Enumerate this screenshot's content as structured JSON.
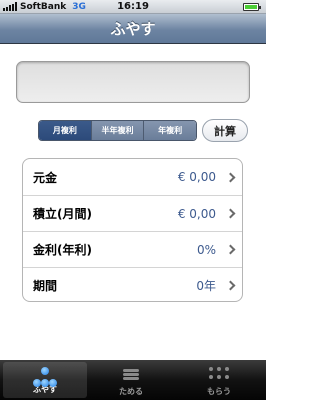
{
  "status_bar": {
    "carrier": "SoftBank",
    "network": "3G",
    "time": "16:19"
  },
  "nav": {
    "title": "ふやす"
  },
  "display": {
    "value": ""
  },
  "segments": [
    {
      "label": "月複利",
      "selected": true
    },
    {
      "label": "半年複利",
      "selected": false
    },
    {
      "label": "年複利",
      "selected": false
    }
  ],
  "calc_button": {
    "label": "計算"
  },
  "rows": [
    {
      "label": "元金",
      "value": "€ 0,00"
    },
    {
      "label": "積立(月間)",
      "value": "€ 0,00"
    },
    {
      "label": "金利(年利)",
      "value": "0%"
    },
    {
      "label": "期間",
      "value": "0年"
    }
  ],
  "tabs": [
    {
      "label": "ふやす",
      "icon": "three-dots-icon",
      "selected": true
    },
    {
      "label": "ためる",
      "icon": "coin-stack-icon",
      "selected": false
    },
    {
      "label": "もらう",
      "icon": "dot-grid-icon",
      "selected": false
    }
  ],
  "colors": {
    "nav_bar": "#6d84a2",
    "segment_selected": "#2c4a7a",
    "row_value": "#3d5a8e",
    "tab_bar": "#121212",
    "tab_icon_active": "#1f7ee6"
  }
}
